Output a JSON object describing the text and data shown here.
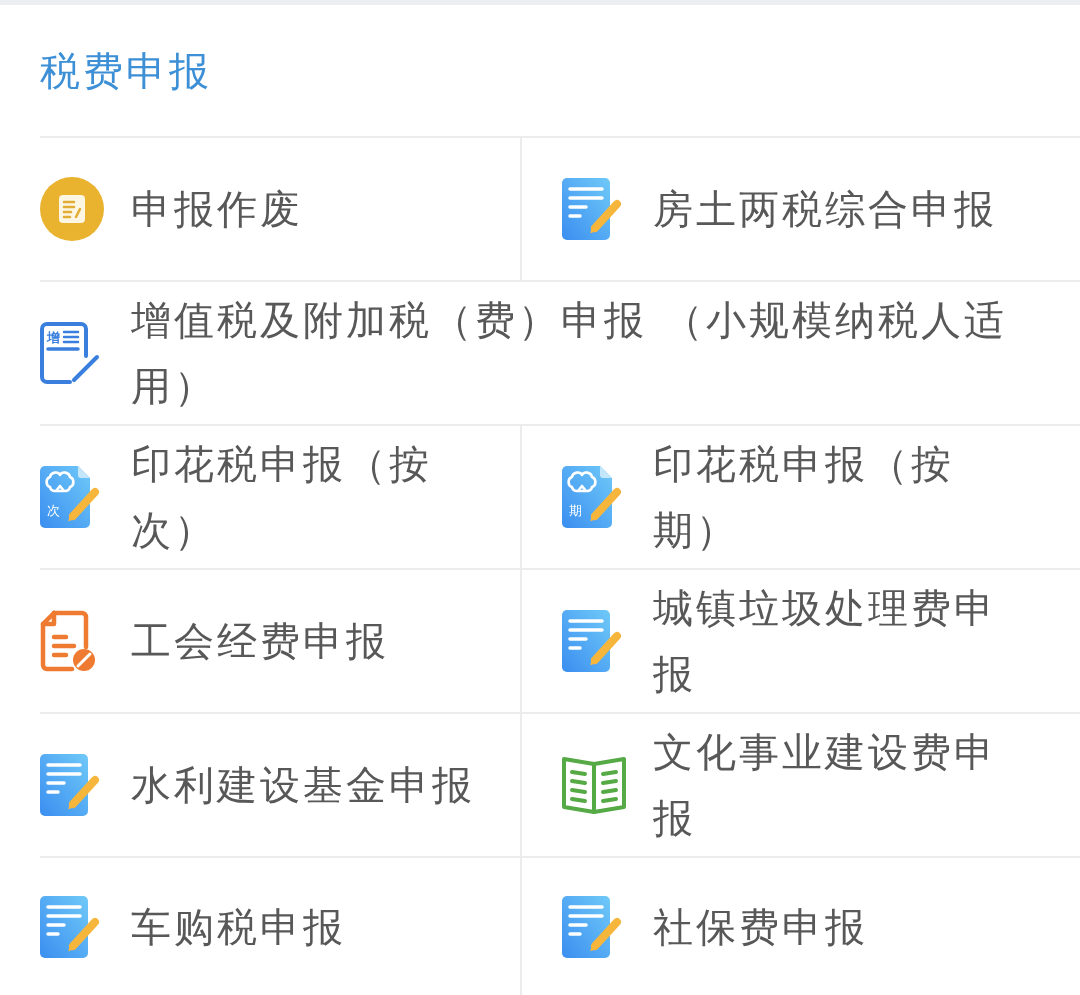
{
  "header": {
    "title": "税费申报"
  },
  "rows": [
    {
      "cells": [
        {
          "kind": "void",
          "label": "申报作废"
        },
        {
          "kind": "form",
          "label": "房土两税综合申报"
        }
      ]
    },
    {
      "cells": [
        {
          "kind": "outline",
          "badge": "增",
          "label": "增值税及附加税（费）申报 （小规模纳税人适用）"
        }
      ]
    },
    {
      "cells": [
        {
          "kind": "stamp",
          "badge": "次",
          "label": "印花税申报（按次）"
        },
        {
          "kind": "stamp",
          "badge": "期",
          "label": "印花税申报（按期）"
        }
      ]
    },
    {
      "cells": [
        {
          "kind": "union",
          "label": "工会经费申报"
        },
        {
          "kind": "form",
          "label": "城镇垃圾处理费申报"
        }
      ]
    },
    {
      "cells": [
        {
          "kind": "form",
          "label": "水利建设基金申报"
        },
        {
          "kind": "book",
          "label": "文化事业建设费申报"
        }
      ]
    },
    {
      "cells": [
        {
          "kind": "form",
          "label": "车购税申报"
        },
        {
          "kind": "form",
          "label": "社保费申报"
        }
      ]
    }
  ]
}
